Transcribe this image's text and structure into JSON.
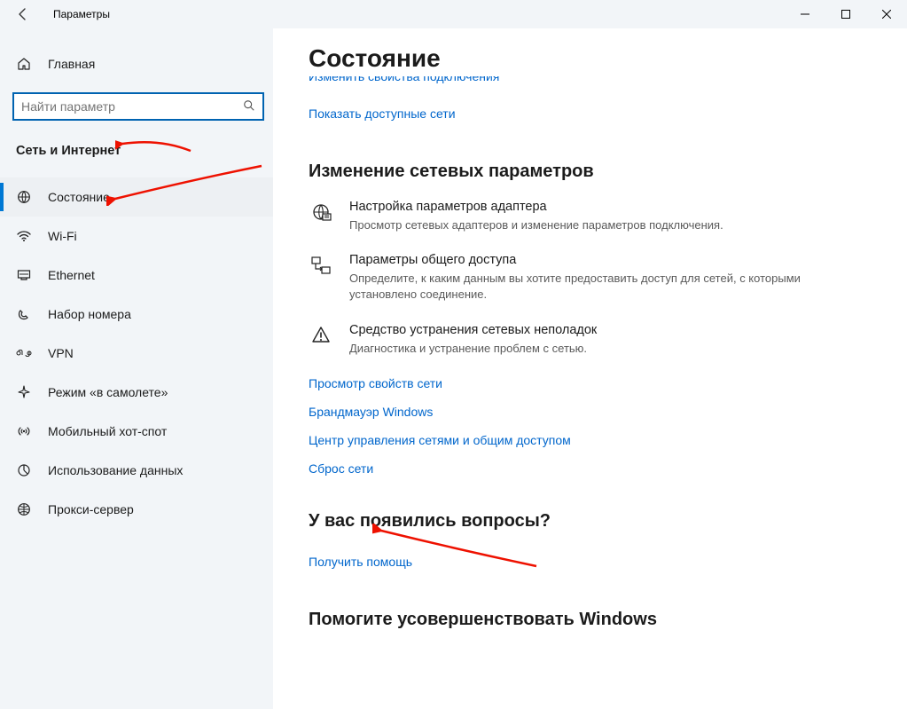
{
  "titlebar": {
    "title": "Параметры"
  },
  "sidebar": {
    "home": "Главная",
    "search_placeholder": "Найти параметр",
    "section": "Сеть и Интернет",
    "items": [
      {
        "label": "Состояние",
        "icon": "globe",
        "active": true
      },
      {
        "label": "Wi-Fi",
        "icon": "wifi",
        "active": false
      },
      {
        "label": "Ethernet",
        "icon": "ethernet",
        "active": false
      },
      {
        "label": "Набор номера",
        "icon": "dialup",
        "active": false
      },
      {
        "label": "VPN",
        "icon": "vpn",
        "active": false
      },
      {
        "label": "Режим «в самолете»",
        "icon": "airplane",
        "active": false
      },
      {
        "label": "Мобильный хот-спот",
        "icon": "hotspot",
        "active": false
      },
      {
        "label": "Использование данных",
        "icon": "data",
        "active": false
      },
      {
        "label": "Прокси-сервер",
        "icon": "proxy",
        "active": false
      }
    ]
  },
  "content": {
    "heading": "Состояние",
    "clipped_link": "Изменить свойства подключения",
    "show_networks": "Показать доступные сети",
    "change_heading": "Изменение сетевых параметров",
    "settings": [
      {
        "title": "Настройка параметров адаптера",
        "desc": "Просмотр сетевых адаптеров и изменение параметров подключения.",
        "icon": "adapter"
      },
      {
        "title": "Параметры общего доступа",
        "desc": "Определите, к каким данным вы хотите предоставить доступ для сетей, с которыми установлено соединение.",
        "icon": "sharing"
      },
      {
        "title": "Средство устранения сетевых неполадок",
        "desc": "Диагностика и устранение проблем с сетью.",
        "icon": "troubleshoot"
      }
    ],
    "links": [
      "Просмотр свойств сети",
      "Брандмауэр Windows",
      "Центр управления сетями и общим доступом",
      "Сброс сети"
    ],
    "questions_heading": "У вас появились вопросы?",
    "get_help": "Получить помощь",
    "feedback_heading": "Помогите усовершенствовать Windows"
  }
}
